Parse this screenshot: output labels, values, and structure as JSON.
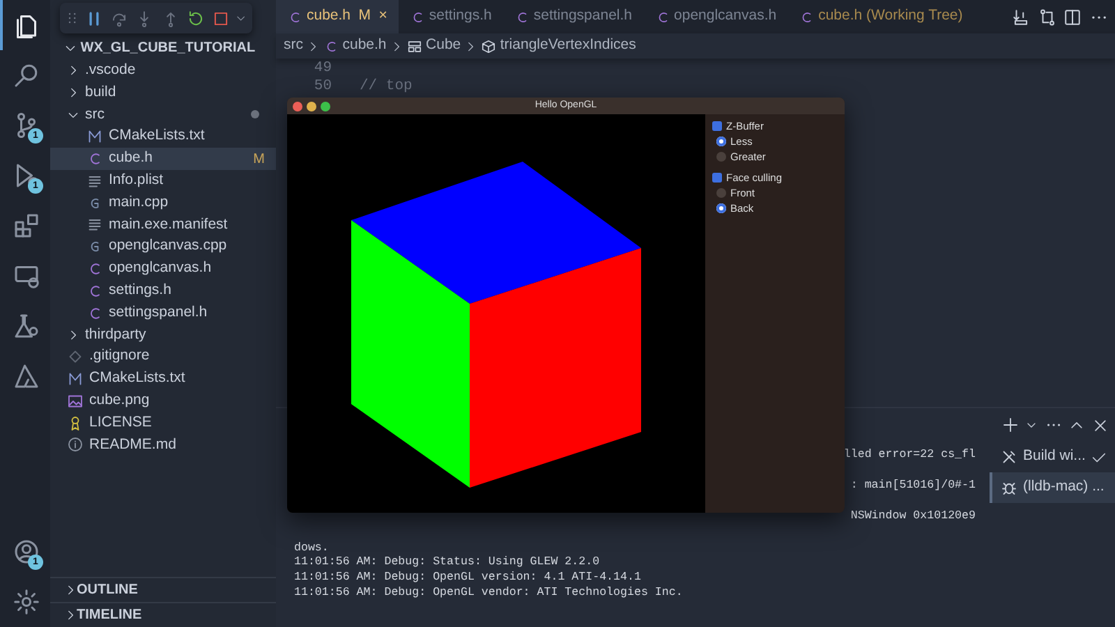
{
  "activity_bar": {
    "items": [
      {
        "kind": "files",
        "selected": true
      },
      {
        "kind": "search",
        "selected": false
      },
      {
        "kind": "source-control",
        "selected": false,
        "badge": "1"
      },
      {
        "kind": "run-debug",
        "selected": false,
        "badge": "1"
      },
      {
        "kind": "extensions",
        "selected": false
      },
      {
        "kind": "remote",
        "selected": false
      },
      {
        "kind": "testing",
        "selected": false
      },
      {
        "kind": "azure",
        "selected": false
      }
    ],
    "bottom": [
      {
        "kind": "account",
        "badge": "1"
      },
      {
        "kind": "settings"
      }
    ]
  },
  "debug_toolbar": {
    "buttons": [
      {
        "kind": "pause"
      },
      {
        "kind": "step-over"
      },
      {
        "kind": "step-into"
      },
      {
        "kind": "step-out"
      },
      {
        "kind": "restart"
      },
      {
        "kind": "stop"
      }
    ]
  },
  "sidebar": {
    "title": "WX_GL_CUBE_TUTORIAL",
    "items": [
      {
        "label": ".vscode",
        "kind": "folder",
        "expanded": false
      },
      {
        "label": "build",
        "kind": "folder",
        "expanded": false
      },
      {
        "label": "src",
        "kind": "folder",
        "expanded": true,
        "modified": true,
        "children": [
          {
            "label": "CMakeLists.txt",
            "kind": "cmake",
            "selected": false
          },
          {
            "label": "cube.h",
            "kind": "c-header",
            "selected": true,
            "badge": "M"
          },
          {
            "label": "Info.plist",
            "kind": "text",
            "selected": false
          },
          {
            "label": "main.cpp",
            "kind": "cpp",
            "selected": false
          },
          {
            "label": "main.exe.manifest",
            "kind": "text",
            "selected": false
          },
          {
            "label": "openglcanvas.cpp",
            "kind": "cpp",
            "selected": false
          },
          {
            "label": "openglcanvas.h",
            "kind": "c-header",
            "selected": false
          },
          {
            "label": "settings.h",
            "kind": "c-header",
            "selected": false
          },
          {
            "label": "settingspanel.h",
            "kind": "c-header",
            "selected": false
          }
        ]
      },
      {
        "label": "thirdparty",
        "kind": "folder",
        "expanded": false
      },
      {
        "label": ".gitignore",
        "kind": "git",
        "selected": false
      },
      {
        "label": "CMakeLists.txt",
        "kind": "cmake",
        "selected": false
      },
      {
        "label": "cube.png",
        "kind": "image",
        "selected": false
      },
      {
        "label": "LICENSE",
        "kind": "license",
        "selected": false
      },
      {
        "label": "README.md",
        "kind": "info",
        "selected": false
      }
    ],
    "sections": [
      {
        "label": "OUTLINE",
        "expanded": false
      },
      {
        "label": "TIMELINE",
        "expanded": false
      }
    ]
  },
  "tabs": [
    {
      "label": "cube.h",
      "selected": true,
      "modified": true,
      "badge": "M",
      "close": "×"
    },
    {
      "label": "settings.h",
      "selected": false,
      "modified": false
    },
    {
      "label": "settingspanel.h",
      "selected": false,
      "modified": false
    },
    {
      "label": "openglcanvas.h",
      "selected": false,
      "modified": false
    },
    {
      "label": "cube.h (Working Tree)",
      "selected": false,
      "modified": true
    }
  ],
  "breadcrumb": [
    {
      "label": "src",
      "kind": "folder"
    },
    {
      "label": "cube.h",
      "kind": "c-header"
    },
    {
      "label": "Cube",
      "kind": "struct"
    },
    {
      "label": "triangleVertexIndices",
      "kind": "field"
    }
  ],
  "editor": {
    "lines": [
      {
        "number": "49"
      },
      {
        "number": "50",
        "code": "// top"
      }
    ]
  },
  "app_window": {
    "title": "Hello OpenGL",
    "settings": [
      {
        "kind": "checkbox",
        "label": "Z-Buffer",
        "checked": true
      },
      {
        "kind": "radio",
        "label": "Less",
        "selected": true
      },
      {
        "kind": "radio",
        "label": "Greater",
        "selected": false
      },
      {
        "kind": "checkbox",
        "label": "Face culling",
        "checked": true
      },
      {
        "kind": "radio",
        "label": "Front",
        "selected": false
      },
      {
        "kind": "radio",
        "label": "Back",
        "selected": true
      }
    ]
  },
  "terminal": {
    "lines": [
      {
        "kind": "fragment",
        "text": "lled error=22 cs_fl"
      },
      {
        "kind": "fragment",
        "text": ": main[51016]/0#-1"
      },
      {
        "kind": "fragment",
        "text": "NSWindow 0x10120e9"
      },
      {
        "kind": "line",
        "text": "dows."
      },
      {
        "kind": "line",
        "text": "11:01:56 AM: Debug: Status: Using GLEW 2.2.0"
      },
      {
        "kind": "line",
        "text": "11:01:56 AM: Debug: OpenGL version: 4.1 ATI-4.14.1"
      },
      {
        "kind": "line",
        "text": "11:01:56 AM: Debug: OpenGL vendor: ATI Technologies Inc."
      }
    ],
    "sessions": [
      {
        "label": "Build wi...",
        "kind": "build",
        "done": true,
        "selected": false
      },
      {
        "label": "(lldb-mac) ...",
        "kind": "debug",
        "done": false,
        "selected": true
      }
    ]
  }
}
